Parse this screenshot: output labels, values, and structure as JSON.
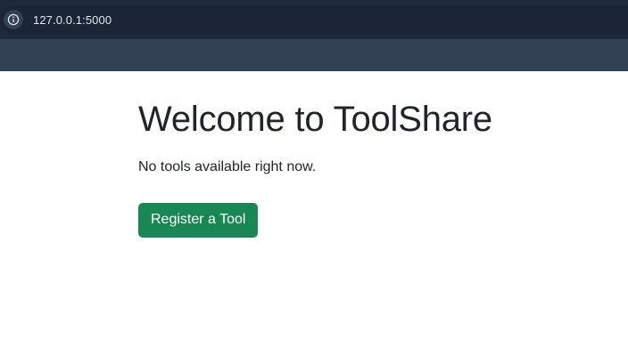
{
  "browser": {
    "url": "127.0.0.1:5000",
    "site_info_icon": "info-icon",
    "colors": {
      "toolbar_bg": "#1e293b",
      "strip_bg": "#334155"
    }
  },
  "page": {
    "title": "Welcome to ToolShare",
    "empty_message": "No tools available right now.",
    "register_button_label": "Register a Tool",
    "colors": {
      "button_bg": "#198754",
      "text": "#212529"
    }
  }
}
